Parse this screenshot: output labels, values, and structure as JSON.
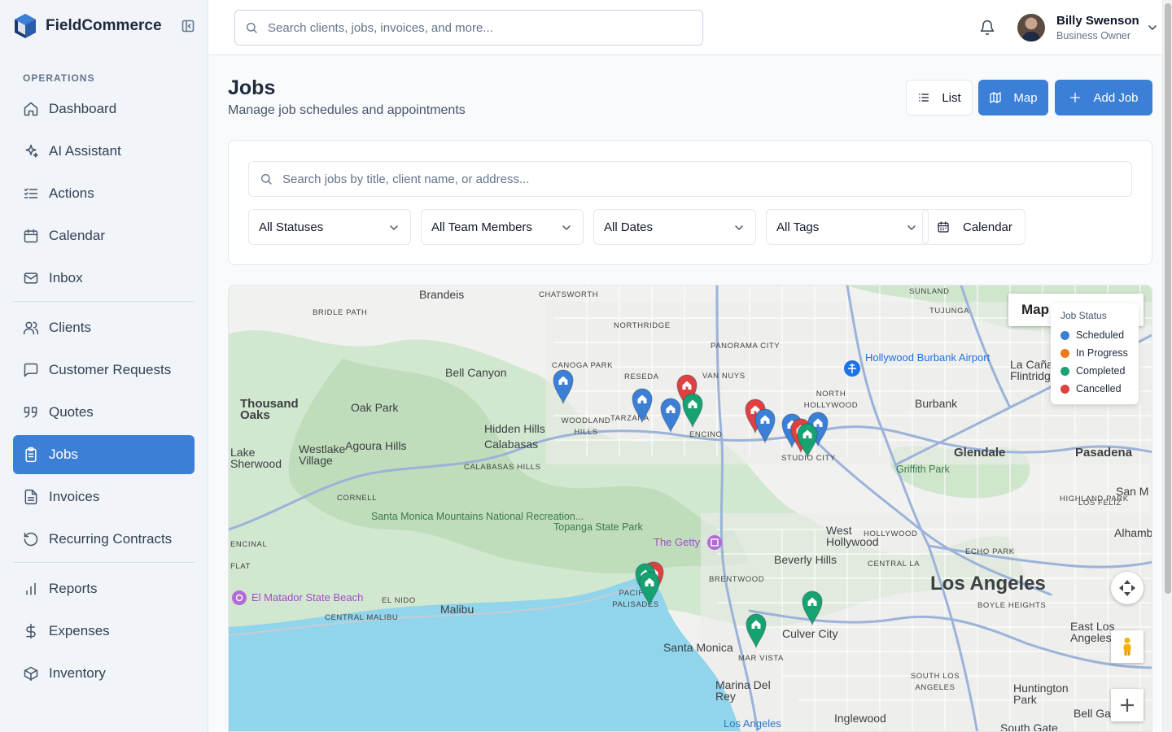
{
  "brand": {
    "name": "FieldCommerce"
  },
  "sidebar": {
    "section_label": "OPERATIONS",
    "items": [
      {
        "label": "Dashboard",
        "icon": "home-icon"
      },
      {
        "label": "AI Assistant",
        "icon": "sparkles-icon"
      },
      {
        "label": "Actions",
        "icon": "list-checks-icon"
      },
      {
        "label": "Calendar",
        "icon": "calendar-icon"
      },
      {
        "label": "Inbox",
        "icon": "mail-icon"
      },
      {
        "label": "Clients",
        "icon": "users-icon"
      },
      {
        "label": "Customer Requests",
        "icon": "message-square-icon"
      },
      {
        "label": "Quotes",
        "icon": "quote-icon"
      },
      {
        "label": "Jobs",
        "icon": "clipboard-icon",
        "active": true
      },
      {
        "label": "Invoices",
        "icon": "file-text-icon"
      },
      {
        "label": "Recurring Contracts",
        "icon": "rotate-icon"
      },
      {
        "label": "Reports",
        "icon": "bar-chart-icon"
      },
      {
        "label": "Expenses",
        "icon": "dollar-icon"
      },
      {
        "label": "Inventory",
        "icon": "package-icon"
      }
    ]
  },
  "topbar": {
    "search_placeholder": "Search clients, jobs, invoices, and more...",
    "user_name": "Billy Swenson",
    "user_role": "Business Owner"
  },
  "page": {
    "title": "Jobs",
    "subtitle": "Manage job schedules and appointments",
    "list_label": "List",
    "map_label": "Map",
    "add_label": "Add Job"
  },
  "filters": {
    "search_placeholder": "Search jobs by title, client name, or address...",
    "status": "All Statuses",
    "team": "All Team Members",
    "dates": "All Dates",
    "tags": "All Tags",
    "calendar_label": "Calendar"
  },
  "map": {
    "map_type_label": "Map",
    "legend_title": "Job Status",
    "legend": [
      {
        "label": "Scheduled",
        "color": "#3b7fd6"
      },
      {
        "label": "In Progress",
        "color": "#ea7a1a"
      },
      {
        "label": "Completed",
        "color": "#16a36f"
      },
      {
        "label": "Cancelled",
        "color": "#e0403f"
      }
    ],
    "labels": [
      {
        "text": "Brandeis",
        "cls": "city"
      },
      {
        "text": "CHATSWORTH",
        "cls": "caps"
      },
      {
        "text": "SUNLAND",
        "cls": "caps"
      },
      {
        "text": "TUJUNGA",
        "cls": "caps"
      },
      {
        "text": "BRIDLE PATH",
        "cls": "caps"
      },
      {
        "text": "NORTHRIDGE",
        "cls": "caps"
      },
      {
        "text": "PANORAMA CITY",
        "cls": "caps"
      },
      {
        "text": "Hollywood Burbank Airport",
        "cls": "air"
      },
      {
        "text": "La Cañada Flintridge",
        "cls": "city"
      },
      {
        "text": "CANOGA PARK",
        "cls": "caps"
      },
      {
        "text": "Bell Canyon",
        "cls": "city"
      },
      {
        "text": "RESEDA",
        "cls": "caps"
      },
      {
        "text": "VAN NUYS",
        "cls": "caps"
      },
      {
        "text": "NORTH HOLLYWOOD",
        "cls": "caps"
      },
      {
        "text": "Thousand Oaks",
        "cls": "big"
      },
      {
        "text": "Oak Park",
        "cls": "city"
      },
      {
        "text": "Burbank",
        "cls": "city"
      },
      {
        "text": "WOODLAND HILLS",
        "cls": "caps"
      },
      {
        "text": "TARZANA",
        "cls": "caps"
      },
      {
        "text": "ENCINO",
        "cls": "caps"
      },
      {
        "text": "Hidden Hills",
        "cls": "city"
      },
      {
        "text": "Calabasas",
        "cls": "city"
      },
      {
        "text": "Westlake Village",
        "cls": "city"
      },
      {
        "text": "Agoura Hills",
        "cls": "city"
      },
      {
        "text": "Lake Sherwood",
        "cls": "city"
      },
      {
        "text": "CALABASAS HILLS",
        "cls": "caps"
      },
      {
        "text": "STUDIO CITY",
        "cls": "caps"
      },
      {
        "text": "Glendale",
        "cls": "big"
      },
      {
        "text": "Pasadena",
        "cls": "big"
      },
      {
        "text": "Griffith Park",
        "cls": "park"
      },
      {
        "text": "CORNELL",
        "cls": "caps"
      },
      {
        "text": "HIGHLAND PARK",
        "cls": "caps"
      },
      {
        "text": "San M",
        "cls": "city"
      },
      {
        "text": "LOS FELIZ",
        "cls": "caps"
      },
      {
        "text": "Santa Monica Mountains National Recreation...",
        "cls": "park"
      },
      {
        "text": "Topanga State Park",
        "cls": "park"
      },
      {
        "text": "The Getty",
        "cls": "poi"
      },
      {
        "text": "West Hollywood",
        "cls": "city"
      },
      {
        "text": "HOLLYWOOD",
        "cls": "caps"
      },
      {
        "text": "Alhambra",
        "cls": "city"
      },
      {
        "text": "ENCINAL",
        "cls": "caps"
      },
      {
        "text": "ECHO PARK",
        "cls": "caps"
      },
      {
        "text": "FLAT",
        "cls": "caps"
      },
      {
        "text": "Beverly Hills",
        "cls": "city"
      },
      {
        "text": "CENTRAL LA",
        "cls": "caps"
      },
      {
        "text": "BRENTWOOD",
        "cls": "caps"
      },
      {
        "text": "Los Angeles",
        "cls": "huge"
      },
      {
        "text": "PACIFIC PALISADES",
        "cls": "caps"
      },
      {
        "text": "El Matador State Beach",
        "cls": "poi"
      },
      {
        "text": "EL NIDO",
        "cls": "caps"
      },
      {
        "text": "Malibu",
        "cls": "city"
      },
      {
        "text": "BOYLE HEIGHTS",
        "cls": "caps"
      },
      {
        "text": "CENTRAL MALIBU",
        "cls": "caps"
      },
      {
        "text": "East Los Angeles",
        "cls": "city"
      },
      {
        "text": "Culver City",
        "cls": "city"
      },
      {
        "text": "Santa Monica",
        "cls": "city"
      },
      {
        "text": "MAR VISTA",
        "cls": "caps"
      },
      {
        "text": "SOUTH LOS ANGELES",
        "cls": "caps"
      },
      {
        "text": "Marina Del Rey",
        "cls": "city"
      },
      {
        "text": "Huntington Park",
        "cls": "city"
      },
      {
        "text": "Bell Garde",
        "cls": "city"
      },
      {
        "text": "Inglewood",
        "cls": "city"
      },
      {
        "text": "Los Angeles",
        "cls": "water"
      },
      {
        "text": "South Gate",
        "cls": "city"
      }
    ],
    "pins": [
      {
        "status": "scheduled"
      },
      {
        "status": "cancelled"
      },
      {
        "status": "scheduled"
      },
      {
        "status": "completed"
      },
      {
        "status": "scheduled"
      },
      {
        "status": "cancelled"
      },
      {
        "status": "scheduled"
      },
      {
        "status": "scheduled"
      },
      {
        "status": "cancelled"
      },
      {
        "status": "scheduled"
      },
      {
        "status": "completed"
      },
      {
        "status": "cancelled"
      },
      {
        "status": "completed"
      },
      {
        "status": "completed"
      },
      {
        "status": "completed"
      },
      {
        "status": "completed"
      }
    ]
  }
}
